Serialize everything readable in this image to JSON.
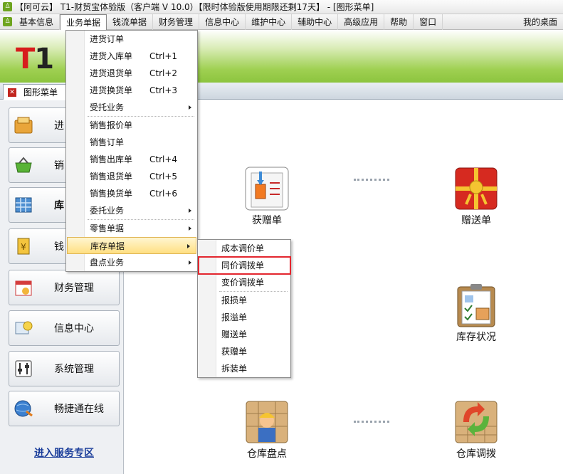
{
  "window": {
    "title": "【阿可云】 T1-财贸宝体验版（客户端 V 10.0）【限时体验版使用期限还剩17天】 - [图形菜单]"
  },
  "menubar": {
    "items": [
      "基本信息",
      "业务单据",
      "钱流单据",
      "财务管理",
      "信息中心",
      "维护中心",
      "辅助中心",
      "高级应用",
      "帮助",
      "窗口"
    ],
    "right": "我的桌面"
  },
  "banner": {
    "logo": "T1"
  },
  "tabbar": {
    "tab_label": "图形菜单"
  },
  "leftnav": {
    "items": [
      {
        "label": "进"
      },
      {
        "label": "销"
      },
      {
        "label": "库"
      },
      {
        "label": "钱"
      },
      {
        "label": "财务管理"
      },
      {
        "label": "信息中心"
      },
      {
        "label": "系统管理"
      },
      {
        "label": "畅捷通在线"
      }
    ],
    "service_link": "进入服务专区"
  },
  "main": {
    "functions": [
      "获赠单",
      "赠送单",
      "库存状况",
      "仓库盘点",
      "仓库调拨"
    ]
  },
  "dropdown": {
    "items": [
      {
        "label": "进货订单",
        "shortcut": ""
      },
      {
        "label": "进货入库单",
        "shortcut": "Ctrl+1"
      },
      {
        "label": "进货退货单",
        "shortcut": "Ctrl+2"
      },
      {
        "label": "进货换货单",
        "shortcut": "Ctrl+3"
      },
      {
        "label": "受托业务",
        "shortcut": ""
      },
      {
        "label": "销售报价单",
        "shortcut": ""
      },
      {
        "label": "销售订单",
        "shortcut": ""
      },
      {
        "label": "销售出库单",
        "shortcut": "Ctrl+4"
      },
      {
        "label": "销售退货单",
        "shortcut": "Ctrl+5"
      },
      {
        "label": "销售换货单",
        "shortcut": "Ctrl+6"
      },
      {
        "label": "委托业务",
        "shortcut": ""
      },
      {
        "label": "零售单据",
        "shortcut": ""
      },
      {
        "label": "库存单据",
        "shortcut": ""
      },
      {
        "label": "盘点业务",
        "shortcut": ""
      }
    ]
  },
  "submenu": {
    "items": [
      "成本调价单",
      "同价调拨单",
      "变价调拨单",
      "报损单",
      "报溢单",
      "赠送单",
      "获赠单",
      "拆装单"
    ]
  },
  "colors": {
    "accent_green": "#8cc43e",
    "highlight_box": "#e3262e",
    "logo_red": "#d71d1d"
  }
}
